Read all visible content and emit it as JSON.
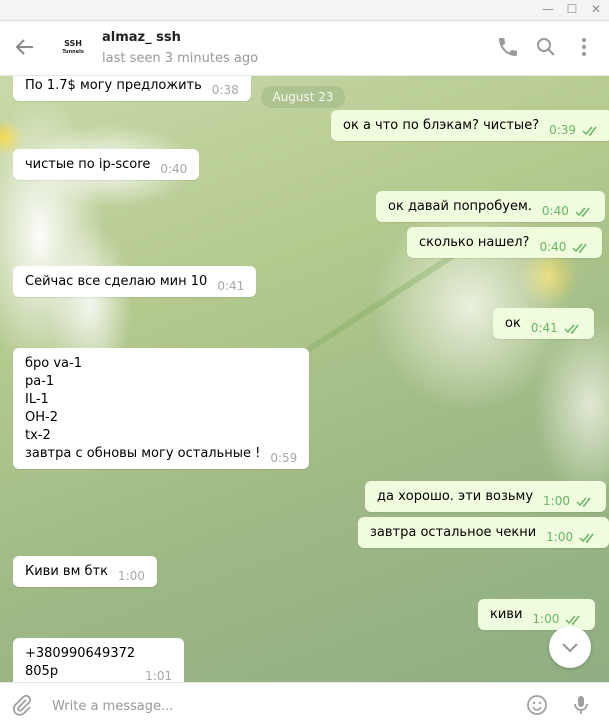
{
  "window": {
    "minimize": "—",
    "maximize": "☐",
    "close": "✕"
  },
  "header": {
    "avatar_line1": "SSH",
    "avatar_line2": "Tunnels",
    "peer_name": "almaz_ ssh",
    "peer_status": "last seen 3 minutes ago"
  },
  "chat": {
    "date_separator": "August 23",
    "messages": [
      {
        "dir": "in",
        "text": "По 1.7$ могу предложить",
        "time": "0:38"
      },
      {
        "dir": "out",
        "text": "ок а что по блэкам? чистые?",
        "time": "0:39",
        "read": true
      },
      {
        "dir": "in",
        "text": "чистые по ip-score",
        "time": "0:40"
      },
      {
        "dir": "out",
        "text": "ок давай попробуем.",
        "time": "0:40",
        "read": true
      },
      {
        "dir": "out",
        "text": "сколько нашел?",
        "time": "0:40",
        "read": true
      },
      {
        "dir": "in",
        "text": "Сейчас все сделаю мин 10",
        "time": "0:41"
      },
      {
        "dir": "out",
        "text": "ок",
        "time": "0:41",
        "read": true
      },
      {
        "dir": "in",
        "text": "бро va-1\npa-1\nIL-1\nOH-2\ntx-2\nзавтра с обновы могу остальные !",
        "time": "0:59"
      },
      {
        "dir": "out",
        "text": "да хорошо. эти возьму",
        "time": "1:00",
        "read": true
      },
      {
        "dir": "out",
        "text": "завтра остальное чекни",
        "time": "1:00",
        "read": true
      },
      {
        "dir": "in",
        "text": "Киви вм бтк",
        "time": "1:00"
      },
      {
        "dir": "out",
        "text": "киви",
        "time": "1:00",
        "read": true
      },
      {
        "dir": "in",
        "text": "+380990649372\n805р",
        "time": "1:01"
      }
    ]
  },
  "compose": {
    "placeholder": "Write a message..."
  },
  "icons": {
    "back": "arrow-left-icon",
    "call": "phone-icon",
    "search": "search-icon",
    "more": "more-vertical-icon",
    "attach": "paperclip-icon",
    "emoji": "emoji-icon",
    "voice": "microphone-icon",
    "scroll_down": "chevron-down-icon",
    "read": "double-check-icon"
  },
  "colors": {
    "incoming_bubble": "#ffffff",
    "outgoing_bubble": "#effdde",
    "outgoing_meta": "#6bb568",
    "incoming_meta": "#a8a8a8"
  }
}
